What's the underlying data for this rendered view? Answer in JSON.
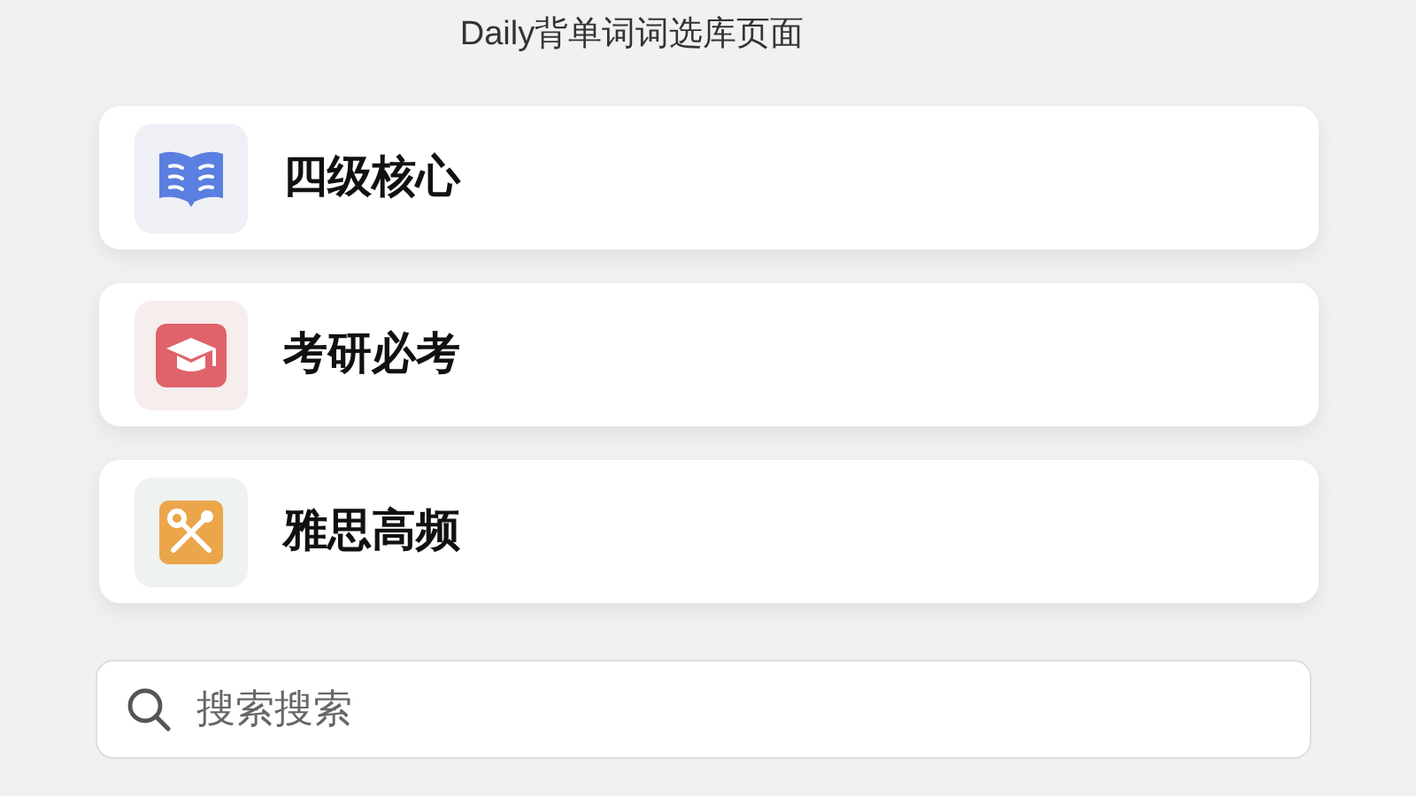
{
  "title": "Daily背单词词选库页面",
  "items": [
    {
      "label": "四级核心"
    },
    {
      "label": "考研必考"
    },
    {
      "label": "雅思高频"
    }
  ],
  "search": {
    "placeholder": "搜索搜索"
  }
}
